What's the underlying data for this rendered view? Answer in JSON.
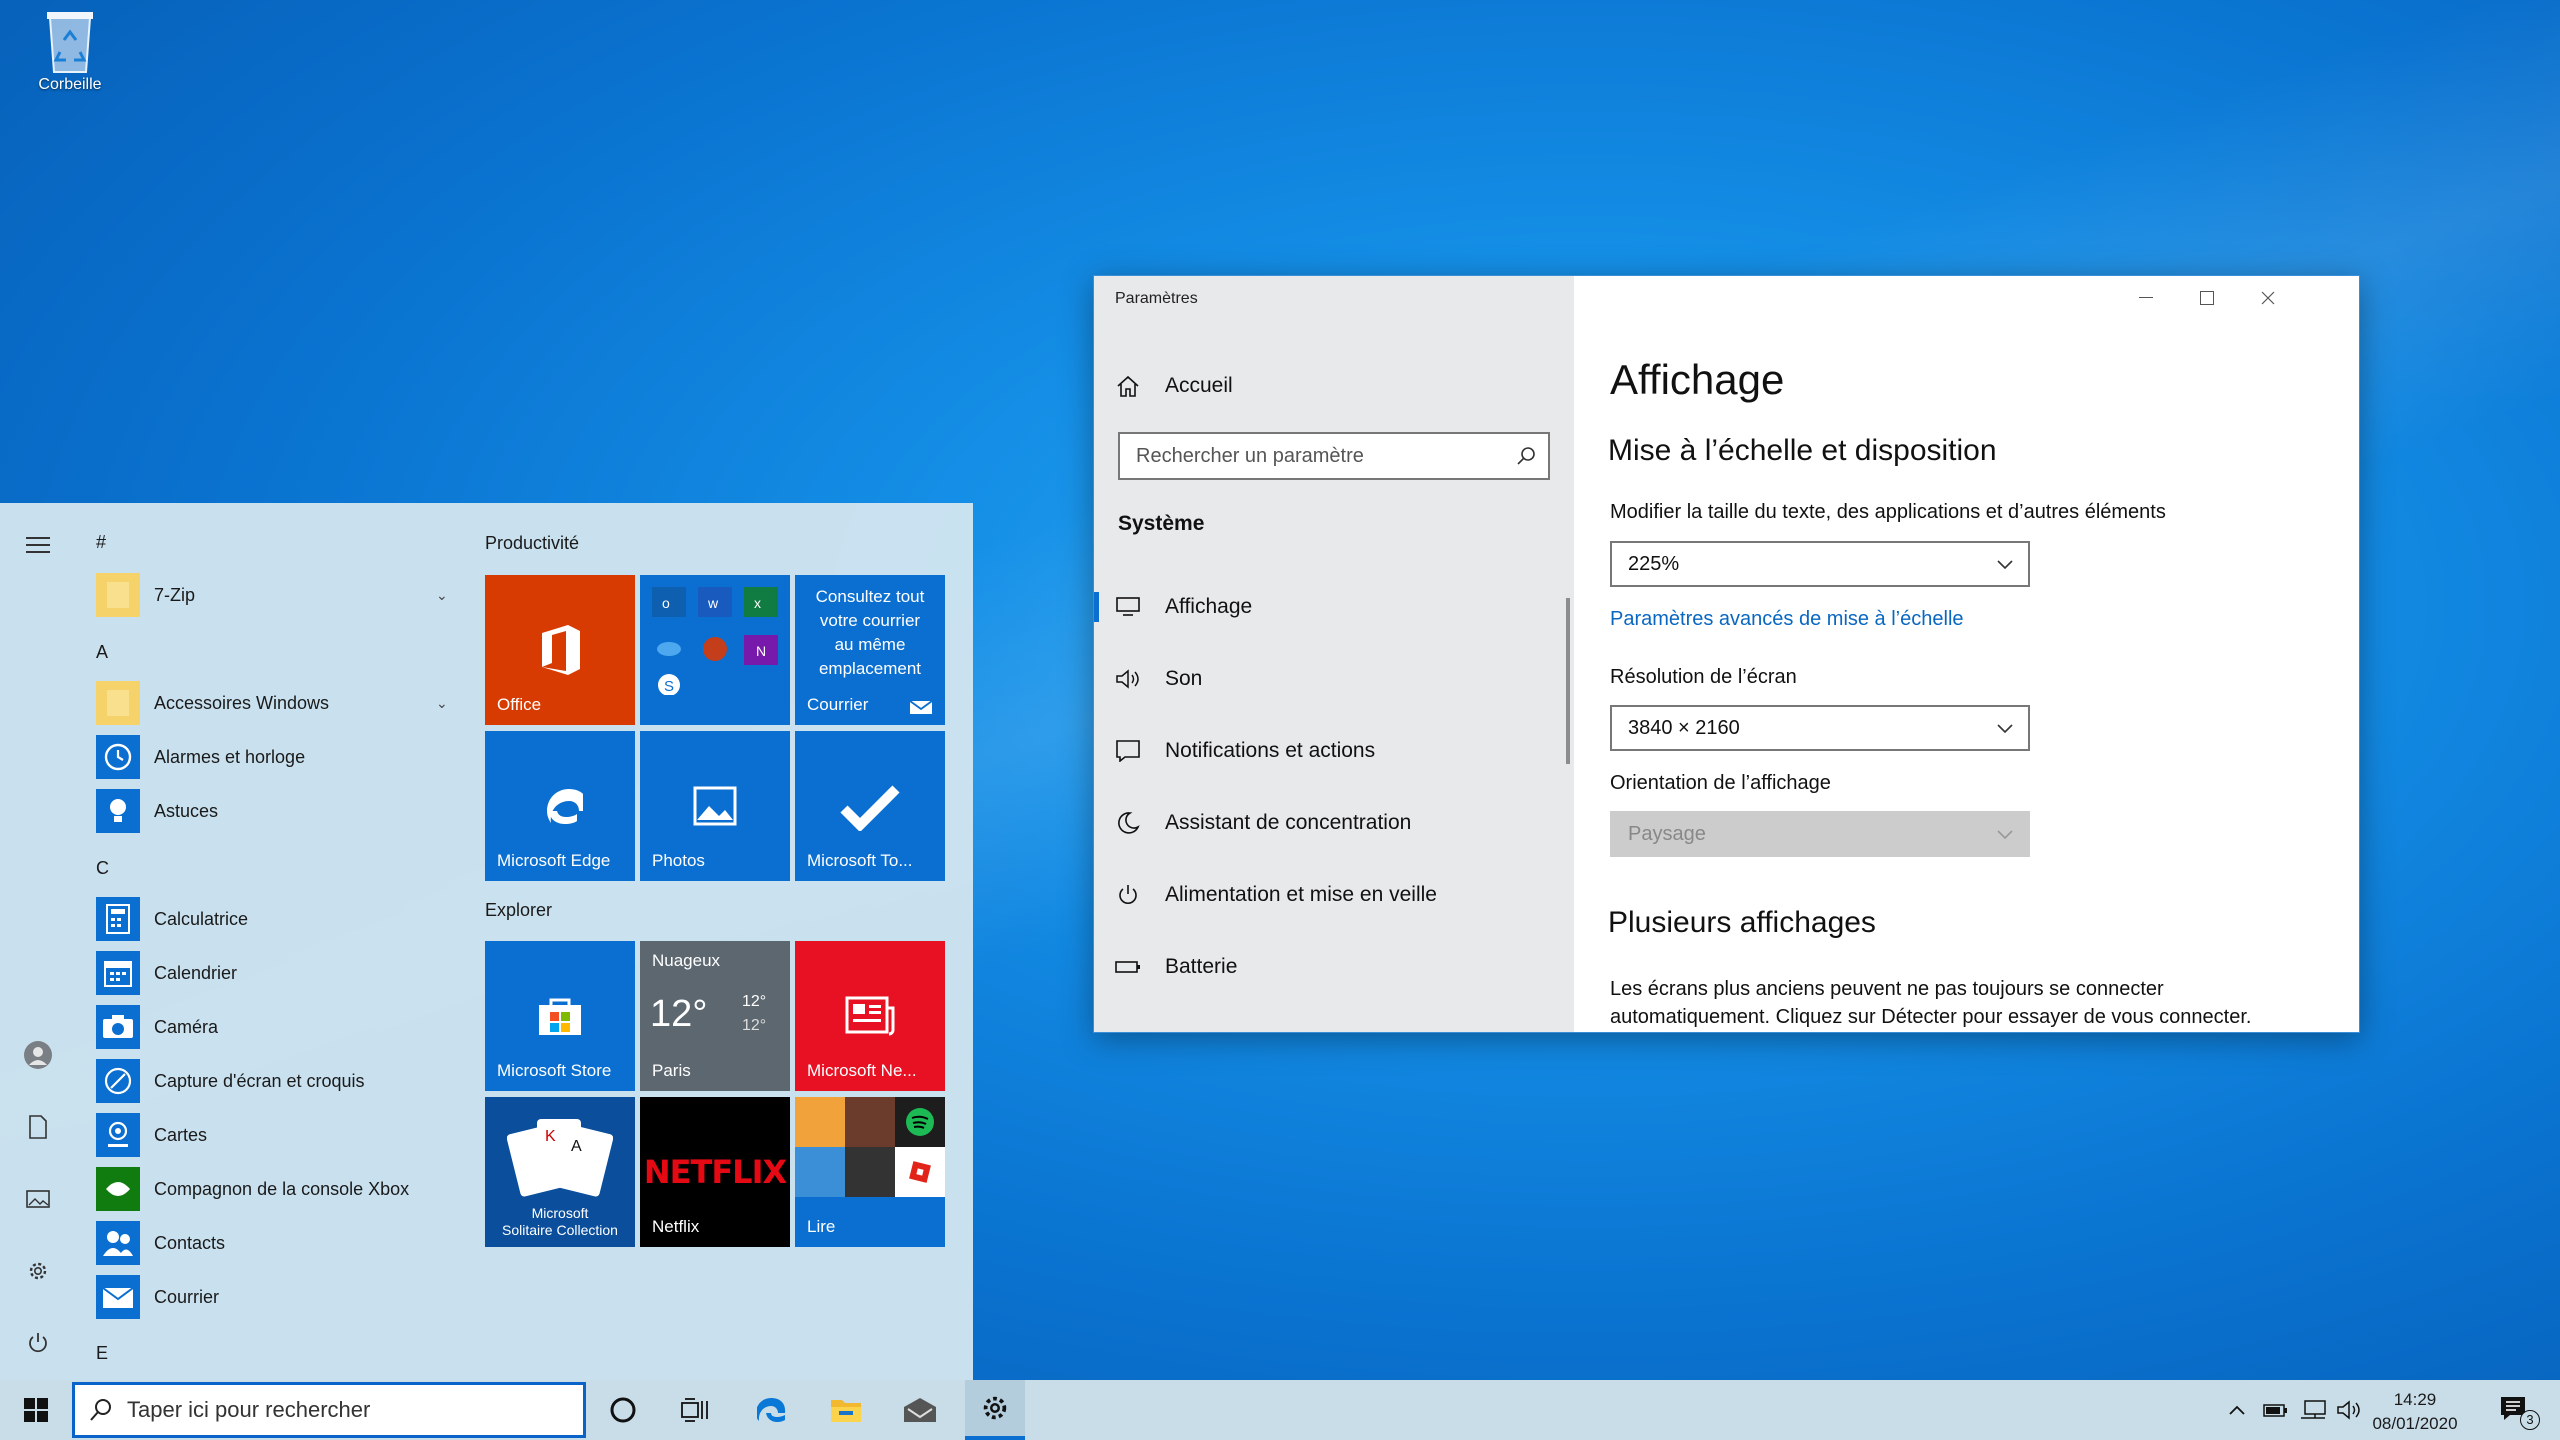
{
  "desktop": {
    "recycle_bin_label": "Corbeille"
  },
  "start": {
    "headers": {
      "hash": "#",
      "a": "A",
      "c": "C",
      "e": "E"
    },
    "apps": [
      {
        "label": "7-Zip",
        "icon": "folder-icon"
      },
      {
        "label": "Accessoires Windows",
        "icon": "folder-icon"
      },
      {
        "label": "Alarmes et horloge",
        "icon": "clock-icon"
      },
      {
        "label": "Astuces",
        "icon": "lightbulb-icon"
      },
      {
        "label": "Calculatrice",
        "icon": "calculator-icon"
      },
      {
        "label": "Calendrier",
        "icon": "calendar-icon"
      },
      {
        "label": "Caméra",
        "icon": "camera-icon"
      },
      {
        "label": "Capture d'écran et croquis",
        "icon": "snip-icon"
      },
      {
        "label": "Cartes",
        "icon": "map-icon"
      },
      {
        "label": "Compagnon de la console Xbox",
        "icon": "xbox-icon"
      },
      {
        "label": "Contacts",
        "icon": "people-icon"
      },
      {
        "label": "Courrier",
        "icon": "mail-icon"
      }
    ],
    "groups": {
      "productivity": "Productivité",
      "explore": "Explorer"
    },
    "tiles": {
      "office": "Office",
      "mail_text": [
        "Consultez tout",
        "votre courrier",
        "au même",
        "emplacement"
      ],
      "mail": "Courrier",
      "edge": "Microsoft Edge",
      "photos": "Photos",
      "todo": "Microsoft To...",
      "store": "Microsoft Store",
      "weather_cond": "Nuageux",
      "weather_temp": "12°",
      "weather_high": "12°",
      "weather_low": "12°",
      "weather_city": "Paris",
      "news": "Microsoft Ne...",
      "solitaire_1": "Microsoft",
      "solitaire_2": "Solitaire Collection",
      "netflix_logo": "NETFLIX",
      "netflix": "Netflix",
      "play": "Lire"
    }
  },
  "taskbar": {
    "search_placeholder": "Taper ici pour rechercher",
    "time": "14:29",
    "date": "08/01/2020",
    "notification_count": "3"
  },
  "settings": {
    "window_title": "Paramètres",
    "home": "Accueil",
    "search_placeholder": "Rechercher un paramètre",
    "section": "Système",
    "nav": [
      {
        "label": "Affichage",
        "icon": "monitor-icon"
      },
      {
        "label": "Son",
        "icon": "speaker-icon"
      },
      {
        "label": "Notifications et actions",
        "icon": "notification-icon"
      },
      {
        "label": "Assistant de concentration",
        "icon": "moon-icon"
      },
      {
        "label": "Alimentation et mise en veille",
        "icon": "power-icon"
      },
      {
        "label": "Batterie",
        "icon": "battery-icon"
      }
    ],
    "page_title": "Affichage",
    "scale_heading": "Mise à l’échelle et disposition",
    "scale_label": "Modifier la taille du texte, des applications et d’autres éléments",
    "scale_value": "225%",
    "advanced_link": "Paramètres avancés de mise à l’échelle",
    "resolution_label": "Résolution de l’écran",
    "resolution_value": "3840 × 2160",
    "orientation_label": "Orientation de l’affichage",
    "orientation_value": "Paysage",
    "multi_heading": "Plusieurs affichages",
    "multi_text": "Les écrans plus anciens peuvent ne pas toujours se connecter automatiquement. Cliquez sur Détecter pour essayer de vous connecter."
  },
  "colors": {
    "accent": "#0a6fd0",
    "office": "#d83b01",
    "news": "#e81123",
    "netflix": "#e50914"
  }
}
